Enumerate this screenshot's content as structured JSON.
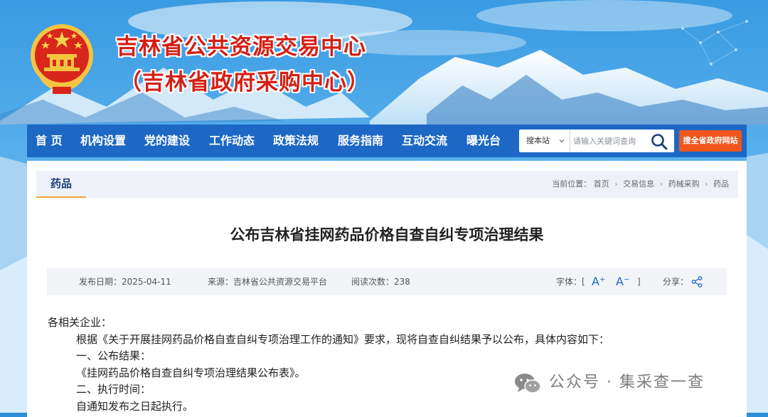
{
  "header": {
    "title": "吉林省公共资源交易中心",
    "subtitle": "（吉林省政府采购中心）"
  },
  "nav": {
    "items": [
      "首 页",
      "机构设置",
      "党的建设",
      "工作动态",
      "政策法规",
      "服务指南",
      "互动交流",
      "曝光台"
    ]
  },
  "search": {
    "scope": "搜本站",
    "placeholder": "请输入关键词查询",
    "gov_button": "搜全省政府网站"
  },
  "section": {
    "tab": "药品",
    "breadcrumb_prefix": "当前位置：",
    "breadcrumbs": [
      "首页",
      "交易信息",
      "药械采购",
      "药品"
    ]
  },
  "article": {
    "title": "公布吉林省挂网药品价格自查自纠专项治理结果",
    "meta": {
      "date": "发布日期：2025-04-11",
      "source": "来源：吉林省公共资源交易平台",
      "views": "阅读次数：238",
      "font_label": "字体：[",
      "font_increase": "A⁺",
      "font_decrease": "A⁻",
      "font_close": "]",
      "share_label": "分享："
    },
    "body": {
      "greeting": "各相关企业：",
      "p1": "根据《关于开展挂网药品价格自查自纠专项治理工作的通知》要求，现将自查自纠结果予以公布，具体内容如下：",
      "h1": "一、公布结果：",
      "p2": "《挂网药品价格自查自纠专项治理结果公布表》。",
      "h2": "二、执行时间：",
      "p3": "自通知发布之日起执行。"
    }
  },
  "watermark": {
    "text": "公众号 · 集采查一查"
  },
  "colors": {
    "title_red": "#d61f14",
    "nav_blue": "#1c68c4",
    "gov_search_orange": "#f0561e",
    "tab_underline": "#f2a23a"
  },
  "icons": [
    "national-emblem-icon",
    "chevron-down-icon",
    "search-icon",
    "share-icon",
    "wechat-icon"
  ]
}
